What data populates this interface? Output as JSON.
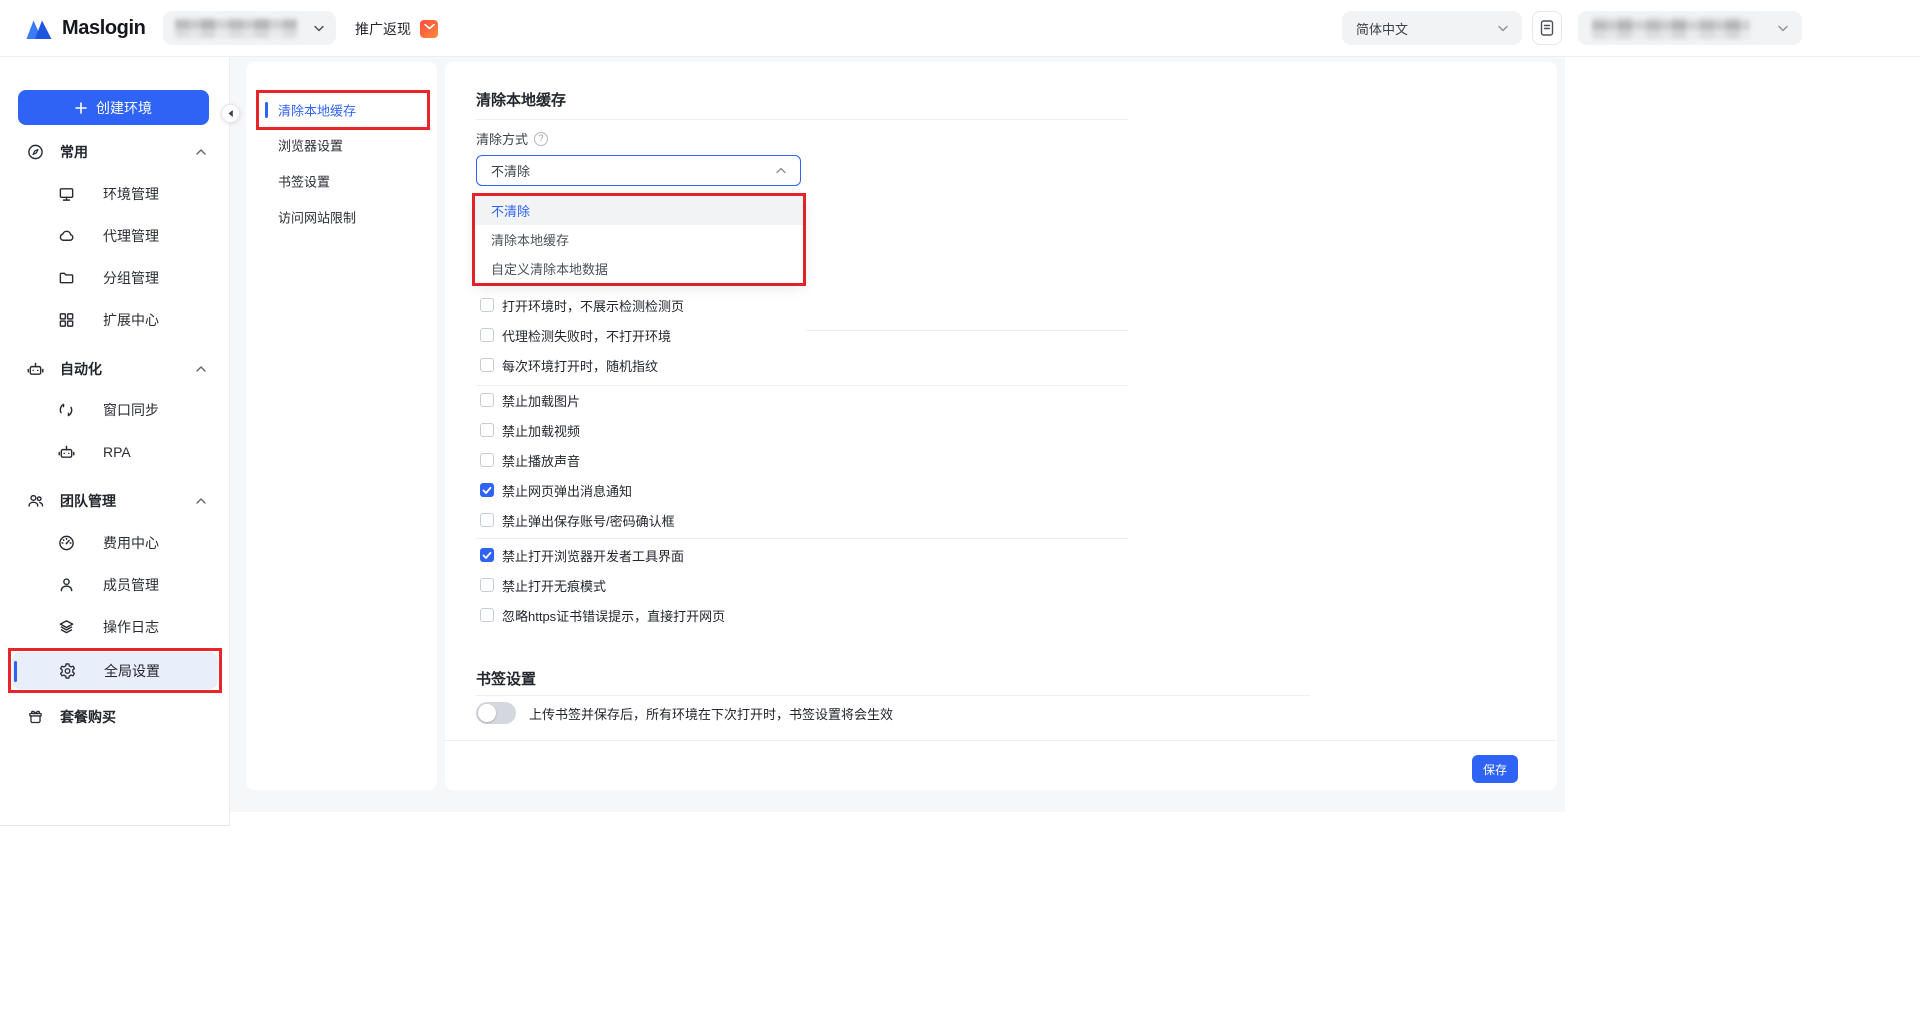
{
  "header": {
    "brand": "Maslogin",
    "promo_label": "推广返现",
    "language": "简体中文"
  },
  "sidebar": {
    "create_label": "创建环境",
    "sections": [
      {
        "label": "常用",
        "items": [
          {
            "label": "环境管理"
          },
          {
            "label": "代理管理"
          },
          {
            "label": "分组管理"
          },
          {
            "label": "扩展中心"
          }
        ]
      },
      {
        "label": "自动化",
        "items": [
          {
            "label": "窗口同步"
          },
          {
            "label": "RPA"
          }
        ]
      },
      {
        "label": "团队管理",
        "items": [
          {
            "label": "费用中心"
          },
          {
            "label": "成员管理"
          },
          {
            "label": "操作日志"
          },
          {
            "label": "全局设置",
            "active": true
          }
        ]
      }
    ],
    "footer_item": "套餐购买"
  },
  "settings_nav": {
    "items": [
      {
        "label": "清除本地缓存",
        "active": true
      },
      {
        "label": "浏览器设置"
      },
      {
        "label": "书签设置"
      },
      {
        "label": "访问网站限制"
      }
    ]
  },
  "main": {
    "section1": {
      "title": "清除本地缓存",
      "field_label": "清除方式",
      "select_value": "不清除",
      "dropdown_options": [
        {
          "label": "不清除",
          "selected": true
        },
        {
          "label": "清除本地缓存",
          "selected": false
        },
        {
          "label": "自定义清除本地数据",
          "selected": false
        }
      ],
      "checkbox_groups": [
        {
          "items": [
            {
              "label": "打开环境时，不展示检测检测页",
              "checked": false
            },
            {
              "label": "代理检测失败时，不打开环境",
              "checked": false
            },
            {
              "label": "每次环境打开时，随机指纹",
              "checked": false
            }
          ]
        },
        {
          "items": [
            {
              "label": "禁止加载图片",
              "checked": false
            },
            {
              "label": "禁止加载视频",
              "checked": false
            },
            {
              "label": "禁止播放声音",
              "checked": false
            },
            {
              "label": "禁止网页弹出消息通知",
              "checked": true
            },
            {
              "label": "禁止弹出保存账号/密码确认框",
              "checked": false
            }
          ]
        },
        {
          "items": [
            {
              "label": "禁止打开浏览器开发者工具界面",
              "checked": true
            },
            {
              "label": "禁止打开无痕模式",
              "checked": false
            },
            {
              "label": "忽略https证书错误提示，直接打开网页",
              "checked": false
            }
          ]
        }
      ]
    },
    "section2": {
      "title": "书签设置",
      "toggle_on": false,
      "toggle_label": "上传书签并保存后，所有环境在下次打开时，书签设置将会生效"
    },
    "save_label": "保存"
  },
  "colors": {
    "primary": "#2e63f6",
    "annotation": "#e7252b"
  }
}
